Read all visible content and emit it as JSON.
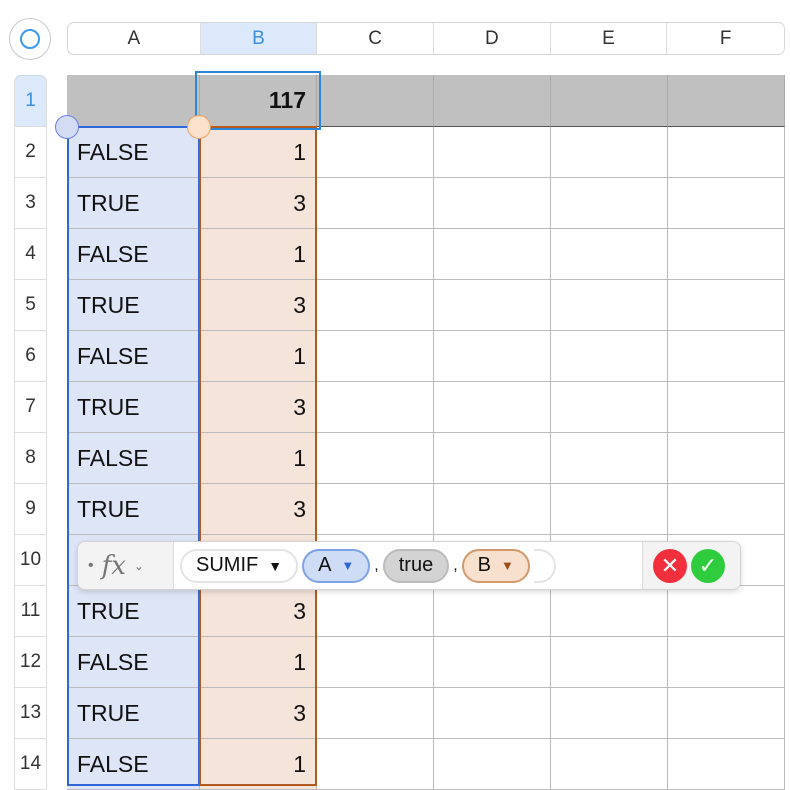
{
  "columns": [
    "A",
    "B",
    "C",
    "D",
    "E",
    "F"
  ],
  "selected_column": "B",
  "rows": [
    {
      "n": "1",
      "a": "",
      "b": "117"
    },
    {
      "n": "2",
      "a": "FALSE",
      "b": "1"
    },
    {
      "n": "3",
      "a": "TRUE",
      "b": "3"
    },
    {
      "n": "4",
      "a": "FALSE",
      "b": "1"
    },
    {
      "n": "5",
      "a": "TRUE",
      "b": "3"
    },
    {
      "n": "6",
      "a": "FALSE",
      "b": "1"
    },
    {
      "n": "7",
      "a": "TRUE",
      "b": "3"
    },
    {
      "n": "8",
      "a": "FALSE",
      "b": "1"
    },
    {
      "n": "9",
      "a": "TRUE",
      "b": "3"
    },
    {
      "n": "10",
      "a": "",
      "b": ""
    },
    {
      "n": "11",
      "a": "TRUE",
      "b": "3"
    },
    {
      "n": "12",
      "a": "FALSE",
      "b": "1"
    },
    {
      "n": "13",
      "a": "TRUE",
      "b": "3"
    },
    {
      "n": "14",
      "a": "FALSE",
      "b": "1"
    }
  ],
  "formula": {
    "fx": "fx",
    "function": "SUMIF",
    "arg1": "A",
    "arg2": "true",
    "arg3": "B",
    "sep": ","
  }
}
